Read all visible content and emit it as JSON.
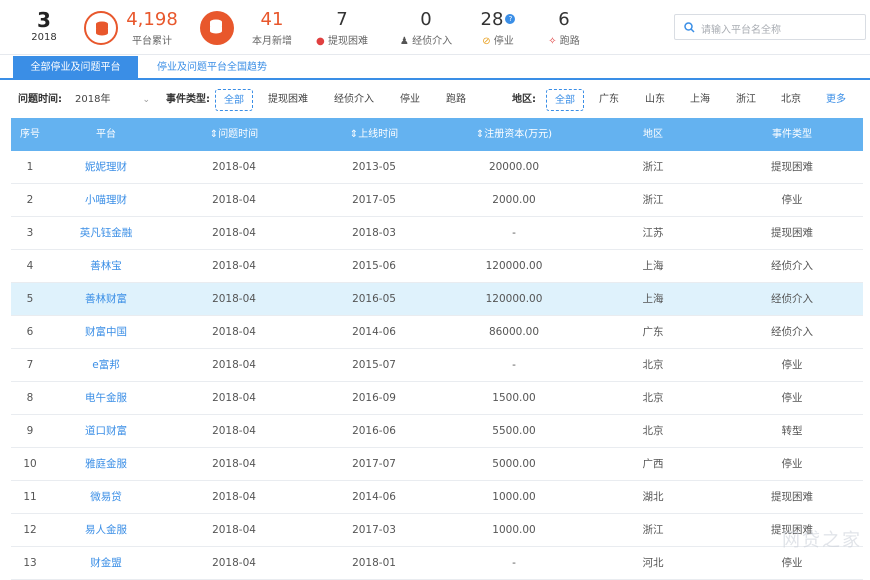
{
  "stats": {
    "year_count": "3",
    "year": "2018",
    "platform_total": "4,198",
    "platform_total_label": "平台累计",
    "month_new": "41",
    "month_new_label": "本月新增",
    "withdraw_difficulty": "7",
    "withdraw_difficulty_label": "提现困难",
    "police": "0",
    "police_label": "经侦介入",
    "stopped": "28",
    "stopped_label": "停业",
    "run": "6",
    "run_label": "跑路"
  },
  "search": {
    "placeholder": "请输入平台名全称"
  },
  "tabs": [
    {
      "label": "全部停业及问题平台"
    },
    {
      "label": "停业及问题平台全国趋势"
    }
  ],
  "filters": {
    "time_label": "问题时间:",
    "year_value": "2018年",
    "type_label": "事件类型:",
    "type_options": [
      "全部",
      "提现困难",
      "经侦介入",
      "停业",
      "跑路"
    ],
    "region_label": "地区:",
    "region_options": [
      "全部",
      "广东",
      "山东",
      "上海",
      "浙江",
      "北京"
    ],
    "more": "更多"
  },
  "table": {
    "headers": [
      "序号",
      "平台",
      "问题时间",
      "上线时间",
      "注册资本(万元)",
      "地区",
      "事件类型"
    ],
    "rows": [
      [
        "1",
        "妮妮理财",
        "2018-04",
        "2013-05",
        "20000.00",
        "浙江",
        "提现困难"
      ],
      [
        "2",
        "小喵理财",
        "2018-04",
        "2017-05",
        "2000.00",
        "浙江",
        "停业"
      ],
      [
        "3",
        "英凡钰金融",
        "2018-04",
        "2018-03",
        "-",
        "江苏",
        "提现困难"
      ],
      [
        "4",
        "善林宝",
        "2018-04",
        "2015-06",
        "120000.00",
        "上海",
        "经侦介入"
      ],
      [
        "5",
        "善林财富",
        "2018-04",
        "2016-05",
        "120000.00",
        "上海",
        "经侦介入"
      ],
      [
        "6",
        "财富中国",
        "2018-04",
        "2014-06",
        "86000.00",
        "广东",
        "经侦介入"
      ],
      [
        "7",
        "e富邦",
        "2018-04",
        "2015-07",
        "-",
        "北京",
        "停业"
      ],
      [
        "8",
        "电午金服",
        "2018-04",
        "2016-09",
        "1500.00",
        "北京",
        "停业"
      ],
      [
        "9",
        "道口财富",
        "2018-04",
        "2016-06",
        "5500.00",
        "北京",
        "转型"
      ],
      [
        "10",
        "雅庭金服",
        "2018-04",
        "2017-07",
        "5000.00",
        "广西",
        "停业"
      ],
      [
        "11",
        "微易贷",
        "2018-04",
        "2014-06",
        "1000.00",
        "湖北",
        "提现困难"
      ],
      [
        "12",
        "易人金服",
        "2018-04",
        "2017-03",
        "1000.00",
        "浙江",
        "提现困难"
      ],
      [
        "13",
        "财金盟",
        "2018-04",
        "2018-01",
        "-",
        "河北",
        "停业"
      ]
    ]
  },
  "colors": {
    "accent": "#3a8ee6",
    "header": "#64b2f0",
    "orange": "#e8572c",
    "highlight_row": "#dff2fc"
  }
}
